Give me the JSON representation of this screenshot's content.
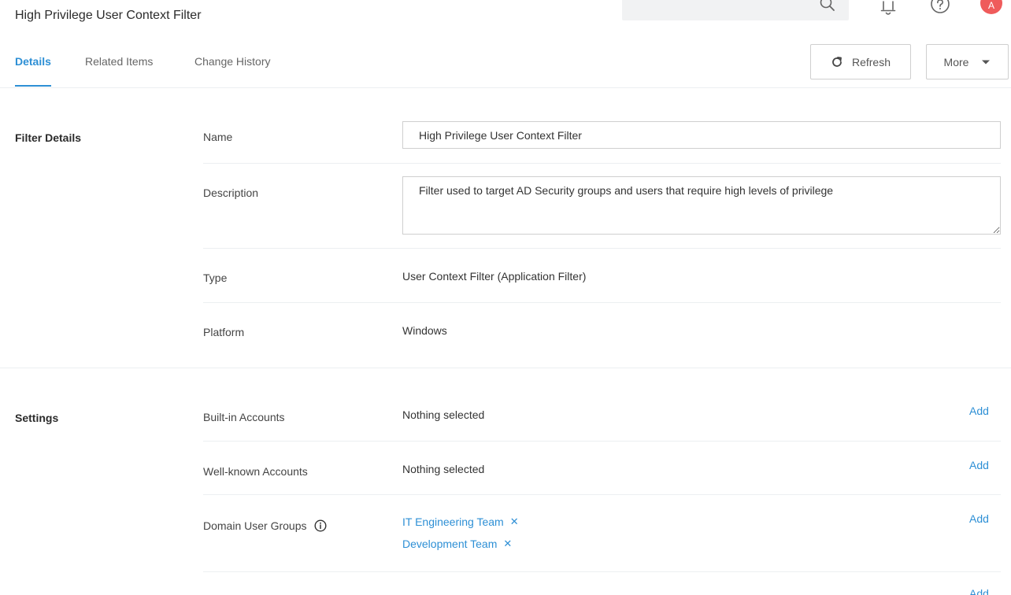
{
  "header": {
    "title": "High Privilege User Context Filter",
    "avatar_initial": "A",
    "avatar_color": "#ef5b5b",
    "accent_color": "#2d8fd5"
  },
  "tabs": [
    {
      "label": "Details",
      "active": true
    },
    {
      "label": "Related Items",
      "active": false
    },
    {
      "label": "Change History",
      "active": false
    }
  ],
  "toolbar": {
    "refresh_label": "Refresh",
    "more_label": "More"
  },
  "filter_details": {
    "section_label": "Filter Details",
    "name_label": "Name",
    "name_value": "High Privilege User Context Filter",
    "description_label": "Description",
    "description_value": "Filter used to target AD Security groups and users that require high levels of privilege",
    "type_label": "Type",
    "type_value": "User Context Filter (Application Filter)",
    "platform_label": "Platform",
    "platform_value": "Windows"
  },
  "settings": {
    "section_label": "Settings",
    "add_label": "Add",
    "builtin_label": "Built-in Accounts",
    "builtin_value": "Nothing selected",
    "wellknown_label": "Well-known Accounts",
    "wellknown_value": "Nothing selected",
    "domain_groups_label": "Domain User Groups",
    "domain_groups": [
      "IT Engineering Team",
      "Development Team"
    ]
  }
}
